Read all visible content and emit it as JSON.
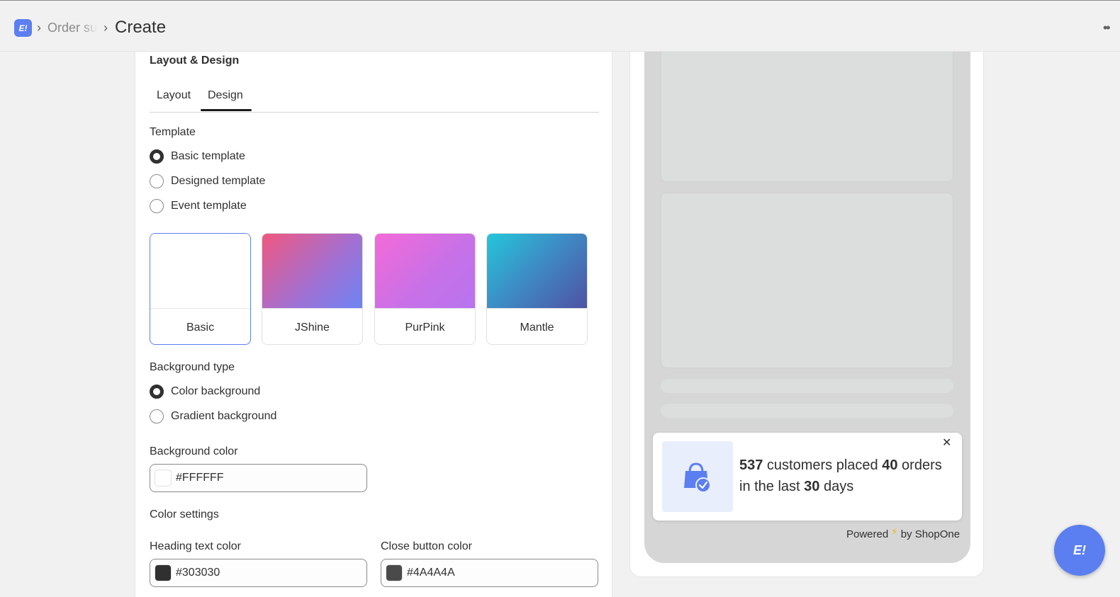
{
  "header": {
    "logo_text": "E!",
    "breadcrumb_parent": "Order su",
    "title": "Create",
    "more_icon": "more-horizontal-icon"
  },
  "section": {
    "title": "Layout & Design",
    "tabs": [
      {
        "label": "Layout",
        "active": false
      },
      {
        "label": "Design",
        "active": true
      }
    ]
  },
  "template": {
    "label": "Template",
    "options": [
      {
        "label": "Basic template",
        "checked": true
      },
      {
        "label": "Designed template",
        "checked": false
      },
      {
        "label": "Event template",
        "checked": false
      }
    ],
    "cards": [
      {
        "name": "Basic",
        "selected": true,
        "background": "#ffffff"
      },
      {
        "name": "JShine",
        "selected": false,
        "background": "linear-gradient(135deg, #f0577f 0%, #a56fd0 55%, #6d84f5 100%)"
      },
      {
        "name": "PurPink",
        "selected": false,
        "background": "linear-gradient(135deg, #f46ad8 0%, #c671e8 60%, #b774ef 100%)"
      },
      {
        "name": "Mantle",
        "selected": false,
        "background": "linear-gradient(135deg, #23c7d9 0%, #3d8ec6 45%, #4f52a4 100%)"
      }
    ]
  },
  "background_type": {
    "label": "Background type",
    "options": [
      {
        "label": "Color background",
        "checked": true
      },
      {
        "label": "Gradient background",
        "checked": false
      }
    ]
  },
  "background_color": {
    "label": "Background color",
    "value": "#FFFFFF",
    "swatch": "#ffffff"
  },
  "color_settings": {
    "label": "Color settings",
    "heading_text_color": {
      "label": "Heading text color",
      "value": "#303030",
      "swatch": "#303030"
    },
    "close_button_color": {
      "label": "Close button color",
      "value": "#4A4A4A",
      "swatch": "#4a4a4a"
    }
  },
  "preview": {
    "count_customers": "537",
    "text_customers": " customers placed ",
    "count_orders": "40",
    "text_orders": " orders in the last ",
    "count_days": "30",
    "text_days": " days",
    "close_symbol": "✕",
    "powered_prefix": "Powered",
    "powered_suffix": "by ShopOne"
  },
  "chat": {
    "logo_text": "E!"
  },
  "colors": {
    "accent": "#5b7ff0",
    "text": "#303030"
  }
}
